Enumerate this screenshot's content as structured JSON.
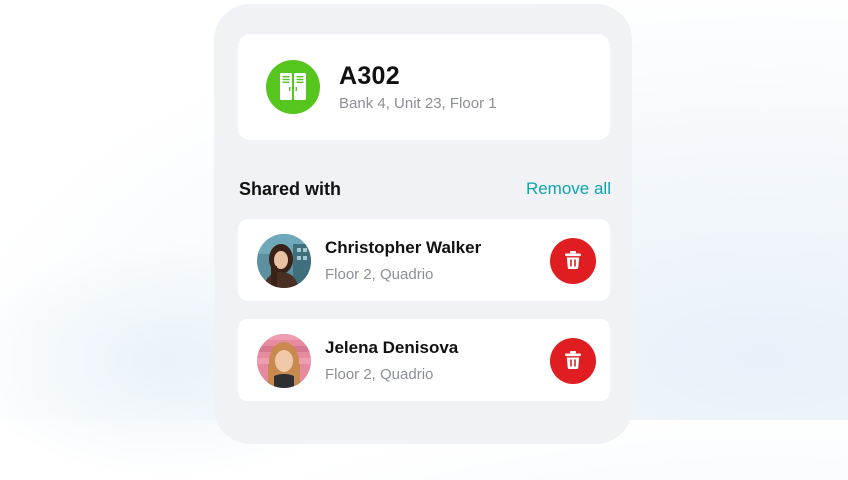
{
  "locker": {
    "name": "A302",
    "location": "Bank 4, Unit 23, Floor 1",
    "icon": "locker-icon",
    "icon_color": "#56c51e"
  },
  "shared": {
    "title": "Shared with",
    "remove_all_label": "Remove all",
    "accent": "#0fa3b1"
  },
  "people": [
    {
      "name": "Christopher Walker",
      "location": "Floor 2, Quadrio"
    },
    {
      "name": "Jelena Denisova",
      "location": "Floor 2, Quadrio"
    }
  ],
  "colors": {
    "delete": "#e01e21",
    "card": "#ffffff",
    "panel": "#f1f2f5"
  }
}
